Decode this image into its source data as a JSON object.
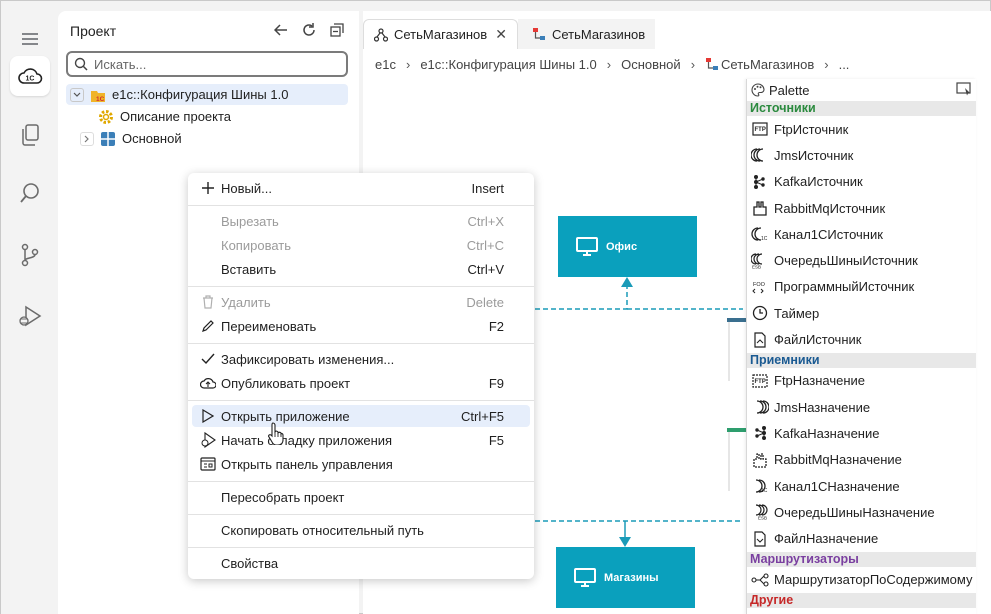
{
  "project": {
    "title": "Проект",
    "search_placeholder": "Искать...",
    "tree": [
      {
        "label": "e1c::Конфигурация Шины 1.0"
      },
      {
        "label": "Описание проекта"
      },
      {
        "label": "Основной"
      }
    ]
  },
  "editor": {
    "tabs": [
      {
        "label": "СетьМагазинов"
      },
      {
        "label": "СетьМагазинов"
      }
    ],
    "breadcrumb": [
      "e1c",
      "e1c::Конфигурация Шины 1.0",
      "Основной",
      "СетьМагазинов",
      "..."
    ]
  },
  "canvas": {
    "nodes": [
      {
        "label": "Офис"
      },
      {
        "label": "Магазины"
      }
    ]
  },
  "palette": {
    "title": "Palette",
    "sections": [
      {
        "name": "Источники",
        "items": [
          "FtpИсточник",
          "JmsИсточник",
          "KafkaИсточник",
          "RabbitMqИсточник",
          "Канал1СИсточник",
          "ОчередьШиныИсточник",
          "ПрограммныйИсточник",
          "Таймер",
          "ФайлИсточник"
        ]
      },
      {
        "name": "Приемники",
        "items": [
          "FtpНазначение",
          "JmsНазначение",
          "KafkaНазначение",
          "RabbitMqНазначение",
          "Канал1СНазначение",
          "ОчередьШиныНазначение",
          "ФайлНазначение"
        ]
      },
      {
        "name": "Маршрутизаторы",
        "items": [
          "МаршрутизаторПоСодержимому"
        ]
      },
      {
        "name": "Другие",
        "items": []
      }
    ]
  },
  "context_menu": {
    "items": [
      {
        "label": "Новый...",
        "shortcut": "Insert",
        "enabled": true,
        "icon": "plus-icon"
      },
      {
        "label": "Вырезать",
        "shortcut": "Ctrl+X",
        "enabled": false,
        "icon": ""
      },
      {
        "label": "Копировать",
        "shortcut": "Ctrl+C",
        "enabled": false,
        "icon": ""
      },
      {
        "label": "Вставить",
        "shortcut": "Ctrl+V",
        "enabled": true,
        "icon": ""
      },
      {
        "label": "Удалить",
        "shortcut": "Delete",
        "enabled": false,
        "icon": "trash-icon"
      },
      {
        "label": "Переименовать",
        "shortcut": "F2",
        "enabled": true,
        "icon": "pencil-icon"
      },
      {
        "label": "Зафиксировать изменения...",
        "shortcut": "",
        "enabled": true,
        "icon": "check-icon"
      },
      {
        "label": "Опубликовать проект",
        "shortcut": "F9",
        "enabled": true,
        "icon": "cloud-upload-icon"
      },
      {
        "label": "Открыть приложение",
        "shortcut": "Ctrl+F5",
        "enabled": true,
        "icon": "play-icon"
      },
      {
        "label": "Начать отладку приложения",
        "shortcut": "F5",
        "enabled": true,
        "icon": "debug-icon"
      },
      {
        "label": "Открыть панель управления",
        "shortcut": "",
        "enabled": true,
        "icon": "dashboard-icon"
      },
      {
        "label": "Пересобрать проект",
        "shortcut": "",
        "enabled": true,
        "icon": ""
      },
      {
        "label": "Скопировать относительный путь",
        "shortcut": "",
        "enabled": true,
        "icon": ""
      },
      {
        "label": "Свойства",
        "shortcut": "",
        "enabled": true,
        "icon": ""
      }
    ]
  },
  "colors": {
    "node_fill": "#0aa0bd",
    "accent_yellow": "#f5c300",
    "sources_section": "#2b8a3e",
    "receivers_section": "#1a5a92",
    "routers_section": "#7a3fa0",
    "other_section": "#c62828",
    "menu_hover": "#e6eefb"
  }
}
